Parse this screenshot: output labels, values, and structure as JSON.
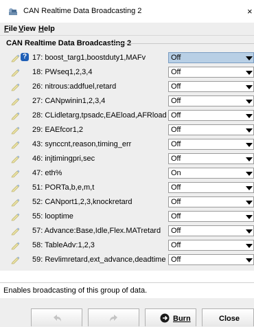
{
  "window": {
    "title": "CAN Realtime Data Broadcasting 2",
    "close_glyph": "×",
    "icon": "app-icon"
  },
  "menu": {
    "file": "File",
    "view": "View",
    "help": "Help"
  },
  "group_title": "CAN Realtime Data Broadcasting 2",
  "rows": [
    {
      "label": "17: boost_targ1,boostduty1,MAFv",
      "value": "Off",
      "selected": true,
      "help": true
    },
    {
      "label": "18: PWseq1,2,3,4",
      "value": "Off"
    },
    {
      "label": "26: nitrous:addfuel,retard",
      "value": "Off"
    },
    {
      "label": "27: CANpwinin1,2,3,4",
      "value": "Off"
    },
    {
      "label": "28: CLidletarg,tpsadc,EAEload,AFRload",
      "value": "Off"
    },
    {
      "label": "29: EAEfcor1,2",
      "value": "Off"
    },
    {
      "label": "43: synccnt,reason,timing_err",
      "value": "Off"
    },
    {
      "label": "46: injtimingpri,sec",
      "value": "Off"
    },
    {
      "label": "47: eth%",
      "value": "On"
    },
    {
      "label": "51: PORTa,b,e,m,t",
      "value": "Off"
    },
    {
      "label": "52: CANport1,2,3,knockretard",
      "value": "Off"
    },
    {
      "label": "55: looptime",
      "value": "Off"
    },
    {
      "label": "57: Advance:Base,Idle,Flex.MATretard",
      "value": "Off"
    },
    {
      "label": "58: TableAdv:1,2,3",
      "value": "Off"
    },
    {
      "label": "59: Revlimretard,ext_advance,deadtime",
      "value": "Off"
    }
  ],
  "help_glyph": "?",
  "status_text": "Enables broadcasting of this group of data.",
  "buttons": {
    "burn": "Burn",
    "close": "Close"
  },
  "colors": {
    "selected_combo": "#b8cfe5",
    "help_badge": "#1f5fb6"
  }
}
